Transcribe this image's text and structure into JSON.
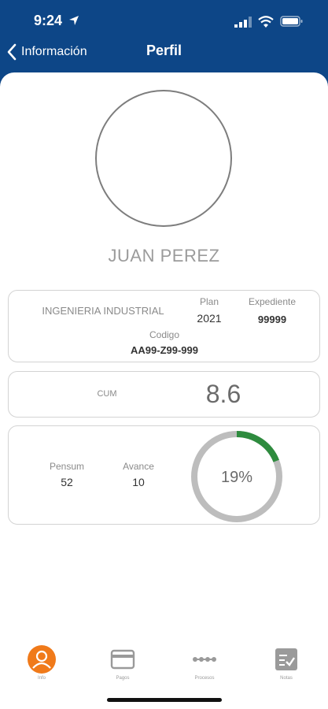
{
  "status_bar": {
    "time": "9:24"
  },
  "nav": {
    "back_label": "Información",
    "title": "Perfil"
  },
  "profile": {
    "name": "JUAN PEREZ",
    "career": "INGENIERIA INDUSTRIAL",
    "plan_label": "Plan",
    "plan_value": "2021",
    "expediente_label": "Expediente",
    "expediente_value": "99999",
    "codigo_label": "Codigo",
    "codigo_value": "AA99-Z99-999"
  },
  "cum": {
    "label": "CUM",
    "value": "8.6"
  },
  "progress": {
    "pensum_label": "Pensum",
    "pensum_value": "52",
    "avance_label": "Avance",
    "avance_value": "10",
    "percent_text": "19%",
    "percent": 0.19,
    "colors": {
      "fill": "#2e8b3e",
      "track": "#bdbdbd"
    }
  },
  "tabs": [
    {
      "label": "Info",
      "icon": "user-icon",
      "active": true
    },
    {
      "label": "Pagos",
      "icon": "credit-card-icon",
      "active": false
    },
    {
      "label": "Procesos",
      "icon": "process-icon",
      "active": false
    },
    {
      "label": "Notas",
      "icon": "grades-icon",
      "active": false
    }
  ],
  "colors": {
    "header": "#0d4687",
    "accent": "#f07a1a"
  }
}
